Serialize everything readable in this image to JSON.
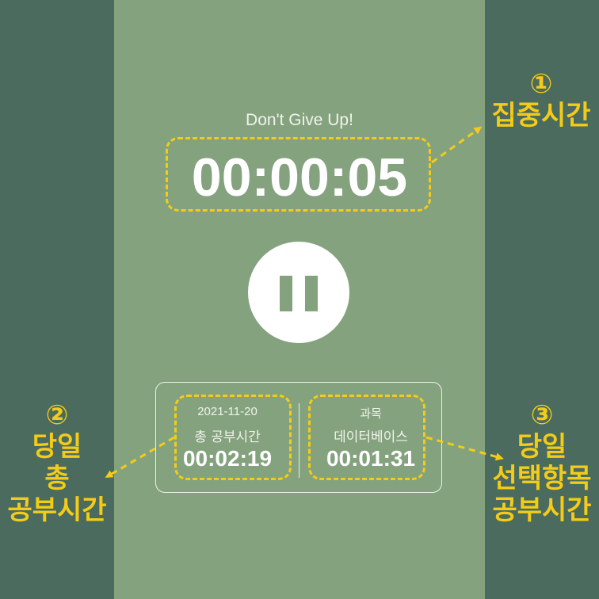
{
  "screen": {
    "motto": "Don't Give Up!",
    "focus_timer": "00:00:05"
  },
  "stats": {
    "date": "2021-11-20",
    "total_label": "총 공부시간",
    "total_time": "00:02:19",
    "subject_caption": "과목",
    "subject_name": "데이터베이스",
    "subject_time": "00:01:31"
  },
  "annotations": {
    "a1_num": "①",
    "a1_text": "집중시간",
    "a2_num": "②",
    "a2_line1": "당일",
    "a2_line2": "총",
    "a2_line3": "공부시간",
    "a3_num": "③",
    "a3_line1": "당일",
    "a3_line2": "선택항목",
    "a3_line3": "공부시간"
  },
  "colors": {
    "background": "#4a6b5e",
    "screen": "#84a27e",
    "annotation": "#f4cc18"
  }
}
